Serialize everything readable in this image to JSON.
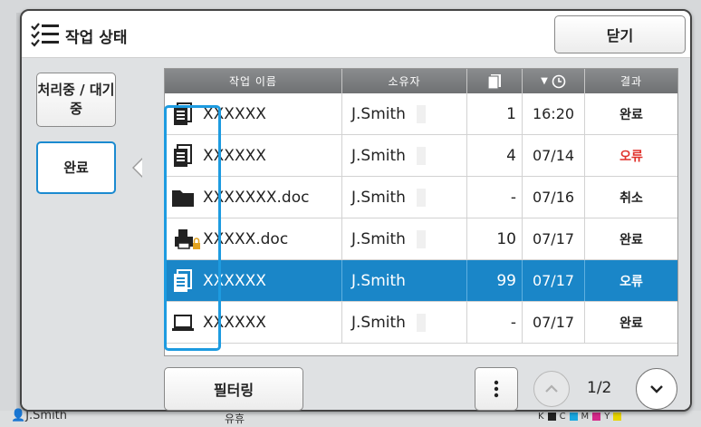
{
  "background": {
    "user": "J.Smith",
    "middle_text": "유휴",
    "ink_labels": [
      "K",
      "C",
      "M",
      "Y"
    ],
    "ink_colors": [
      "#222222",
      "#19a7e0",
      "#d62a8a",
      "#e8d400"
    ]
  },
  "dialog": {
    "title": "작업 상태",
    "close_label": "닫기"
  },
  "tabs": {
    "processing": "처리중 / 대기중",
    "done": "완료"
  },
  "table": {
    "headers": {
      "name": "작업 이름",
      "owner": "소유자",
      "sort_label": "▼"
    },
    "rows": [
      {
        "icon": "document-icon",
        "name": "XXXXXX",
        "owner": "J.Smith",
        "count": "1",
        "time": "16:20",
        "result": "완료",
        "status": "ok"
      },
      {
        "icon": "document-icon",
        "name": "XXXXXX",
        "owner": "J.Smith",
        "count": "4",
        "time": "07/14",
        "result": "오류",
        "status": "error"
      },
      {
        "icon": "folder-icon",
        "name": "XXXXXXX.doc",
        "owner": "J.Smith",
        "count": "-",
        "time": "07/16",
        "result": "취소",
        "status": "ok"
      },
      {
        "icon": "locked-print-icon",
        "name": "XXXXX.doc",
        "owner": "J.Smith",
        "count": "10",
        "time": "07/17",
        "result": "완료",
        "status": "ok"
      },
      {
        "icon": "document-icon",
        "name": "XXXXXX",
        "owner": "J.Smith",
        "count": "99",
        "time": "07/17",
        "result": "오류",
        "status": "error",
        "selected": true
      },
      {
        "icon": "computer-icon",
        "name": "XXXXXX",
        "owner": "J.Smith",
        "count": "-",
        "time": "07/17",
        "result": "완료",
        "status": "ok"
      }
    ]
  },
  "footer": {
    "filter_label": "필터링",
    "page_indicator": "1/2"
  },
  "colors": {
    "accent": "#1a86c8",
    "error": "#e0302a",
    "header": "#7c7e80"
  }
}
